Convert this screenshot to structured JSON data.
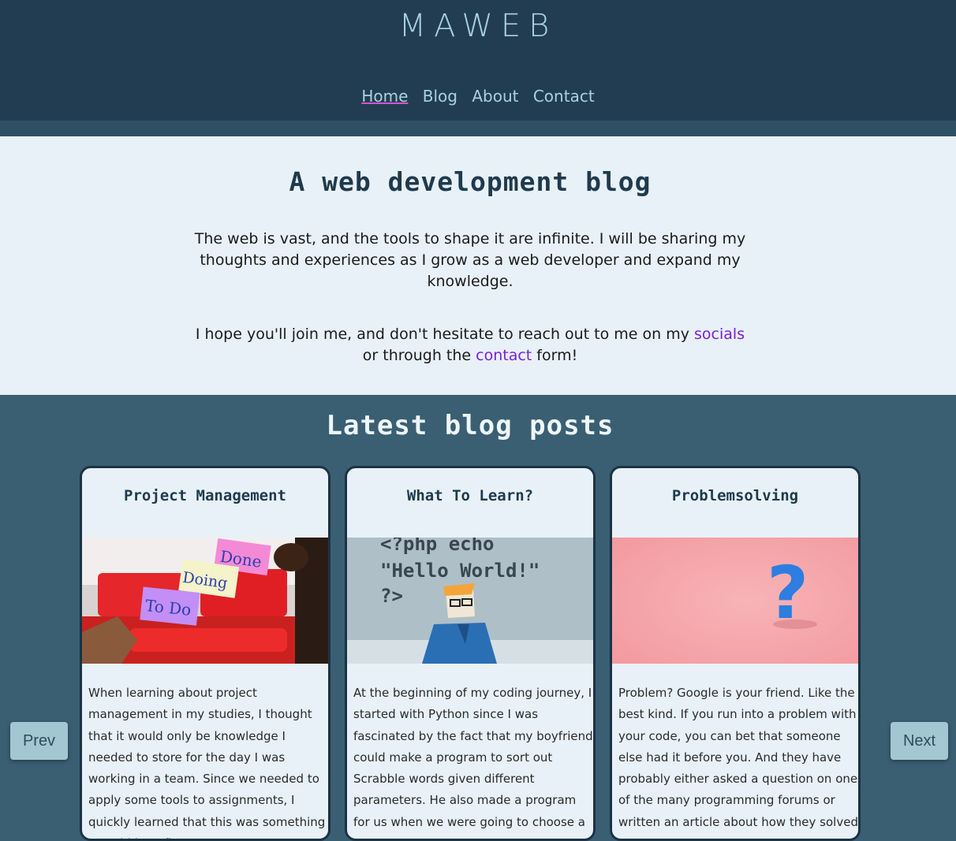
{
  "header": {
    "logo": "MAWEB",
    "nav": [
      {
        "label": "Home",
        "active": true
      },
      {
        "label": "Blog",
        "active": false
      },
      {
        "label": "About",
        "active": false
      },
      {
        "label": "Contact",
        "active": false
      }
    ]
  },
  "intro": {
    "title": "A web development blog",
    "paragraph1": "The web is vast, and the tools to shape it are infinite. I will be sharing my thoughts and experiences as I grow as a web developer and expand my knowledge.",
    "paragraph2_before": "I hope you'll join me, and don't hesitate to reach out to me on my ",
    "socials_link": "socials",
    "paragraph2_middle": " or through the ",
    "contact_link": "contact",
    "paragraph2_after": " form!"
  },
  "posts": {
    "heading": "Latest blog posts",
    "prev_label": "Prev",
    "next_label": "Next",
    "items": [
      {
        "title": "Project Management",
        "image_notes": [
          "Done",
          "Doing",
          "To Do"
        ],
        "excerpt": "When learning about project management in my studies, I thought that it would only be knowledge I needed to store for the day I was working in a team. Since we needed to apply some tools to assignments, I quickly learned that this was something I would benefit"
      },
      {
        "title": "What To Learn?",
        "image_code": [
          "<?php echo",
          "\"Hello World!\"",
          "?>"
        ],
        "excerpt": "At the beginning of my coding journey, I started with Python since I was fascinated by the fact that my boyfriend could make a program to sort out Scrabble words given different parameters. He also made a program for us when we were going to choose a"
      },
      {
        "title": "Problemsolving",
        "image_symbol": "?",
        "excerpt": "Problem? Google is your friend. Like the best kind. If you run into a problem with your code, you can bet that someone else had it before you. And they have probably either asked a question on one of the many programming forums or written an article about how they solved"
      }
    ]
  },
  "colors": {
    "header_bg": "#223d52",
    "section_bg": "#3a5f72",
    "intro_bg": "#e8f1f8",
    "link": "#7a1fd6",
    "accent_underline": "#d652d6"
  }
}
